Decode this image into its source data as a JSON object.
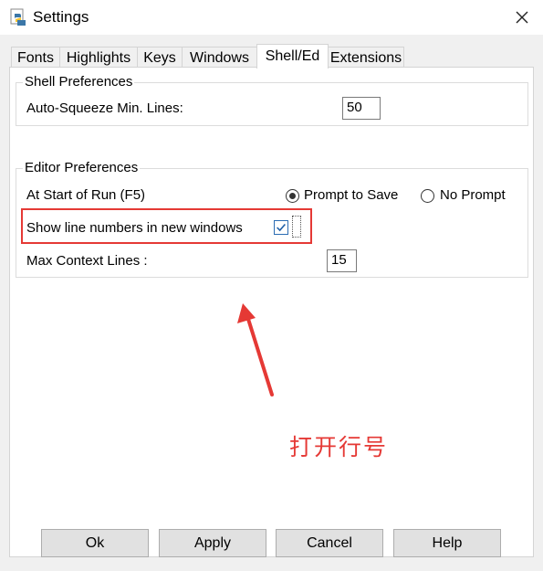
{
  "window": {
    "title": "Settings",
    "close_glyph": "✕"
  },
  "tabs": [
    {
      "label": "Fonts"
    },
    {
      "label": "Highlights"
    },
    {
      "label": "Keys"
    },
    {
      "label": "Windows"
    },
    {
      "label": "Shell/Ed"
    },
    {
      "label": "Extensions"
    }
  ],
  "active_tab": "Shell/Ed",
  "shell": {
    "title": "Shell Preferences",
    "squeeze_label": "Auto-Squeeze Min. Lines:",
    "squeeze_value": "50"
  },
  "editor": {
    "title": "Editor Preferences",
    "start_run_label": "At Start of Run (F5)",
    "prompt_to_save": "Prompt to Save",
    "no_prompt": "No Prompt",
    "selected_option": "Prompt to Save",
    "line_numbers_label": "Show line numbers in new windows",
    "line_numbers_checked": true,
    "context_label": "Max Context Lines :",
    "context_value": "15"
  },
  "annotation": {
    "text": "打开行号",
    "color": "#e53935"
  },
  "buttons": {
    "ok": "Ok",
    "apply": "Apply",
    "cancel": "Cancel",
    "help": "Help"
  }
}
